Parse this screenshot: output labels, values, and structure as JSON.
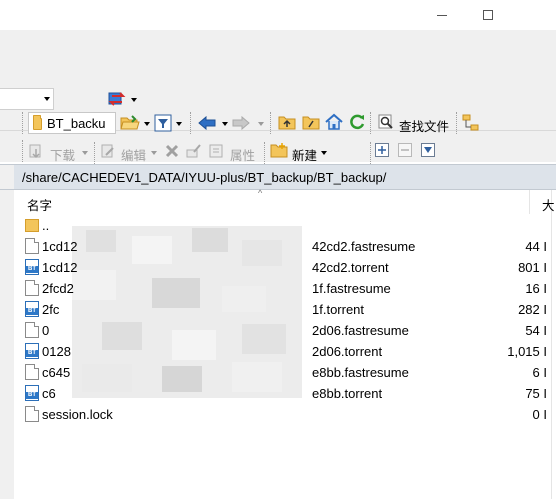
{
  "window": {
    "minimize_icon": "minimize-icon",
    "maximize_icon": "maximize-icon"
  },
  "toolbar1": {
    "path_combo_value": "BT_backu",
    "find_files_label": "查找文件"
  },
  "toolbar2": {
    "download_label": "下载",
    "edit_label": "编辑",
    "properties_label": "属性",
    "new_label": "新建"
  },
  "pathbar": {
    "path": "/share/CACHEDEV1_DATA/IYUU-plus/BT_backup/BT_backup/"
  },
  "columns": {
    "name": "名字",
    "size": "大"
  },
  "files": [
    {
      "name": "..",
      "size": "",
      "icon": "parent-folder-icon"
    },
    {
      "name": "1cd12",
      "name_tail": "42cd2.fastresume",
      "size": "44 I",
      "icon": "file-icon"
    },
    {
      "name": "1cd12",
      "name_tail": "42cd2.torrent",
      "size": "801 I",
      "icon": "torrent-icon"
    },
    {
      "name": "2fcd2",
      "name_tail": "1f.fastresume",
      "size": "16 I",
      "icon": "file-icon"
    },
    {
      "name": "2fc",
      "name_tail": "1f.torrent",
      "size": "282 I",
      "icon": "torrent-icon"
    },
    {
      "name": "0",
      "name_tail": "2d06.fastresume",
      "size": "54 I",
      "icon": "file-icon"
    },
    {
      "name": "0128",
      "name_tail": "2d06.torrent",
      "size": "1,015 I",
      "icon": "torrent-icon"
    },
    {
      "name": "c645",
      "name_tail": "e8bb.fastresume",
      "size": "6 I",
      "icon": "file-icon"
    },
    {
      "name": "c6",
      "name_tail": "e8bb.torrent",
      "size": "75 I",
      "icon": "torrent-icon"
    },
    {
      "name": "session.lock",
      "name_tail": "",
      "size": "0 I",
      "icon": "file-icon"
    }
  ],
  "colors": {
    "pathbar_bg": "#dde3ea",
    "toolbar_bg": "#f0f0f0",
    "folder": "#f3c55b",
    "torrent_blue": "#2d78c8"
  }
}
